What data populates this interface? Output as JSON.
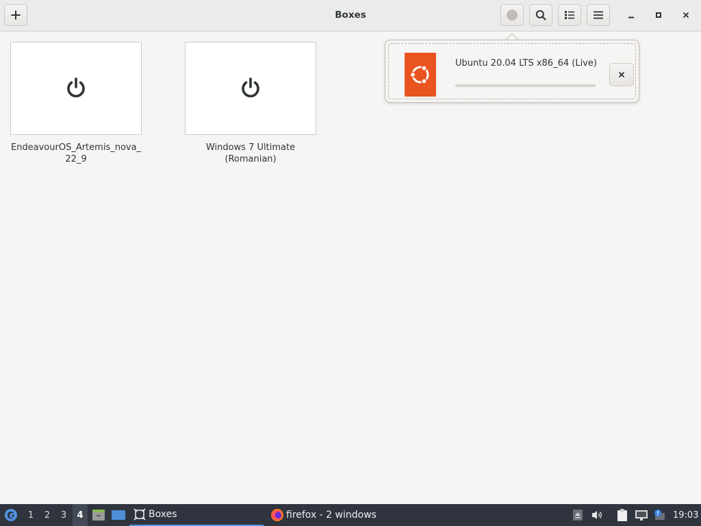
{
  "window": {
    "title": "Boxes"
  },
  "header": {
    "new_button": "plus-icon",
    "downloads_button": "downloads-indicator-icon",
    "search_button": "search-icon",
    "view_button": "list-view-icon",
    "menu_button": "hamburger-menu-icon",
    "minimize": "minimize-icon",
    "maximize": "maximize-icon",
    "close": "close-icon"
  },
  "boxes": [
    {
      "name": "EndeavourOS_Artemis_nova_22_9",
      "icon": "power-icon"
    },
    {
      "name": "Windows 7 Ultimate (Romanian)",
      "icon": "power-icon"
    }
  ],
  "download": {
    "title": "Ubuntu 20.04 LTS x86_64 (Live)",
    "progress": 0,
    "logo_color": "#e95420",
    "cancel_icon": "close-icon"
  },
  "taskbar": {
    "workspaces": [
      "1",
      "2",
      "3",
      "4"
    ],
    "active_workspace": "4",
    "tasks": [
      {
        "label": "Boxes",
        "active": true
      },
      {
        "label": "firefox - 2 windows",
        "active": false
      }
    ],
    "clock": "19:03",
    "accent_color": "#5294e2"
  }
}
